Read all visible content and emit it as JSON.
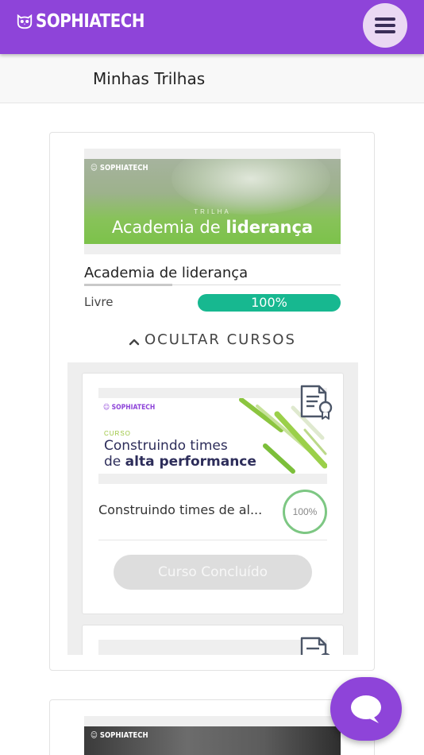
{
  "header": {
    "brand": "SOPHIATECH",
    "menu_icon": "hamburger-icon"
  },
  "page": {
    "title": "Minhas Trilhas"
  },
  "trails": [
    {
      "banner": {
        "logo": "SOPHIATECH",
        "kicker": "TRILHA",
        "title_regular": "Academia de ",
        "title_bold": "liderança"
      },
      "title": "Academia de liderança",
      "status": "Livre",
      "progress_label": "100%",
      "progress_value": 100,
      "toggle_label": "OCULTAR CURSOS",
      "courses": [
        {
          "banner": {
            "logo": "SOPHIATECH",
            "kicker": "CURSO",
            "line1": "Construindo times",
            "line2_regular": "de ",
            "line2_bold": "alta performance"
          },
          "name": "Construindo times de al...",
          "progress_label": "100%",
          "button_label": "Curso Concluído",
          "icon": "certificate-icon"
        }
      ]
    },
    {
      "banner": {
        "logo": "SOPHIATECH"
      }
    }
  ],
  "chat": {
    "icon": "chat-bubble-icon"
  },
  "colors": {
    "brand": "#8e44d9",
    "progress": "#17b890",
    "ring": "#7dc783"
  }
}
